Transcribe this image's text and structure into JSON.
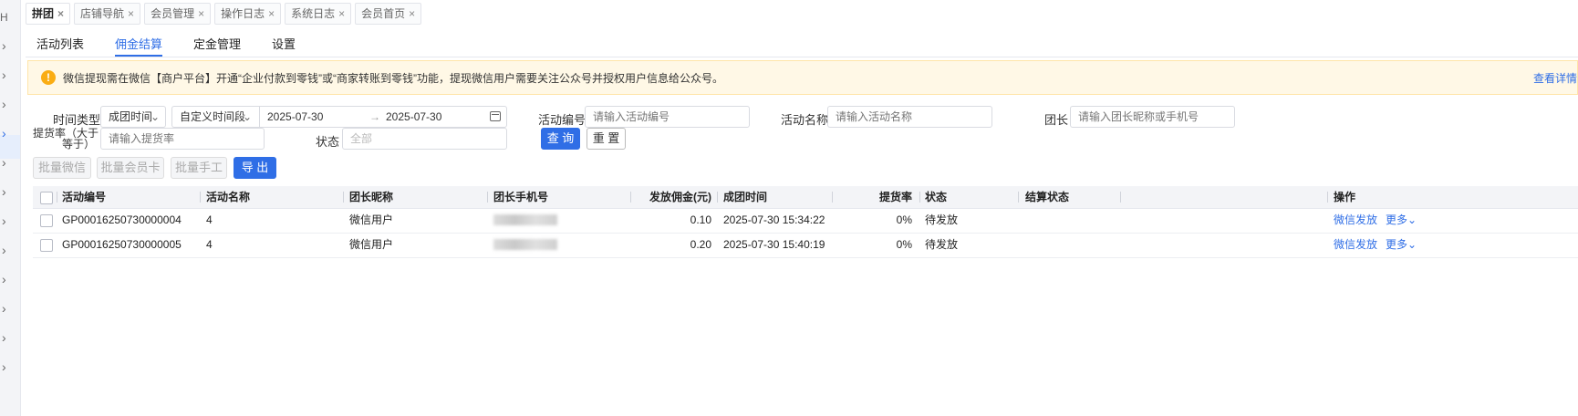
{
  "rail": {
    "top_char": "H"
  },
  "tabs": [
    {
      "label": "拼团",
      "active": true
    },
    {
      "label": "店铺导航",
      "active": false
    },
    {
      "label": "会员管理",
      "active": false
    },
    {
      "label": "操作日志",
      "active": false
    },
    {
      "label": "系统日志",
      "active": false
    },
    {
      "label": "会员首页",
      "active": false
    }
  ],
  "tab_close": "×",
  "subnav": [
    "活动列表",
    "佣金结算",
    "定金管理",
    "设置"
  ],
  "notice": {
    "icon": "!",
    "text": "微信提现需在微信【商户平台】开通“企业付款到零钱”或“商家转账到零钱”功能，提现微信用户需要关注公众号并授权用户信息给公众号。",
    "link": "查看详情"
  },
  "filters": {
    "time_type_label": "时间类型",
    "time_type_value": "成团时间",
    "range_mode_value": "自定义时间段",
    "date_start": "2025-07-30",
    "date_arrow": "→",
    "date_end": "2025-07-30",
    "activity_no_label": "活动编号",
    "activity_no_placeholder": "请输入活动编号",
    "activity_name_label": "活动名称",
    "activity_name_placeholder": "请输入活动名称",
    "leader_label": "团长",
    "leader_placeholder": "请输入团长昵称或手机号",
    "pickup_rate_label_1": "提货率（大于",
    "pickup_rate_label_2": "等于）",
    "pickup_rate_placeholder": "请输入提货率",
    "status_label": "状态",
    "status_value": "全部",
    "query": "查 询",
    "reset": "重 置"
  },
  "batch": {
    "wechat": "批量微信",
    "member_card": "批量会员卡",
    "manual": "批量手工",
    "export": "导 出"
  },
  "table": {
    "headers": {
      "activity_no": "活动编号",
      "activity_name": "活动名称",
      "leader_nick": "团长昵称",
      "leader_phone": "团长手机号",
      "commission": "发放佣金(元)",
      "group_time": "成团时间",
      "pickup_rate": "提货率",
      "status": "状态",
      "settle_status": "结算状态",
      "actions": "操作"
    },
    "rows": [
      {
        "activity_no": "GP00016250730000004",
        "activity_name": "4",
        "leader_nick": "微信用户",
        "commission": "0.10",
        "group_time": "2025-07-30 15:34:22",
        "pickup_rate": "0%",
        "status": "待发放",
        "settle_status": "",
        "action_pay": "微信发放",
        "action_more": "更多"
      },
      {
        "activity_no": "GP00016250730000005",
        "activity_name": "4",
        "leader_nick": "微信用户",
        "commission": "0.20",
        "group_time": "2025-07-30 15:40:19",
        "pickup_rate": "0%",
        "status": "待发放",
        "settle_status": "",
        "action_pay": "微信发放",
        "action_more": "更多"
      }
    ]
  }
}
